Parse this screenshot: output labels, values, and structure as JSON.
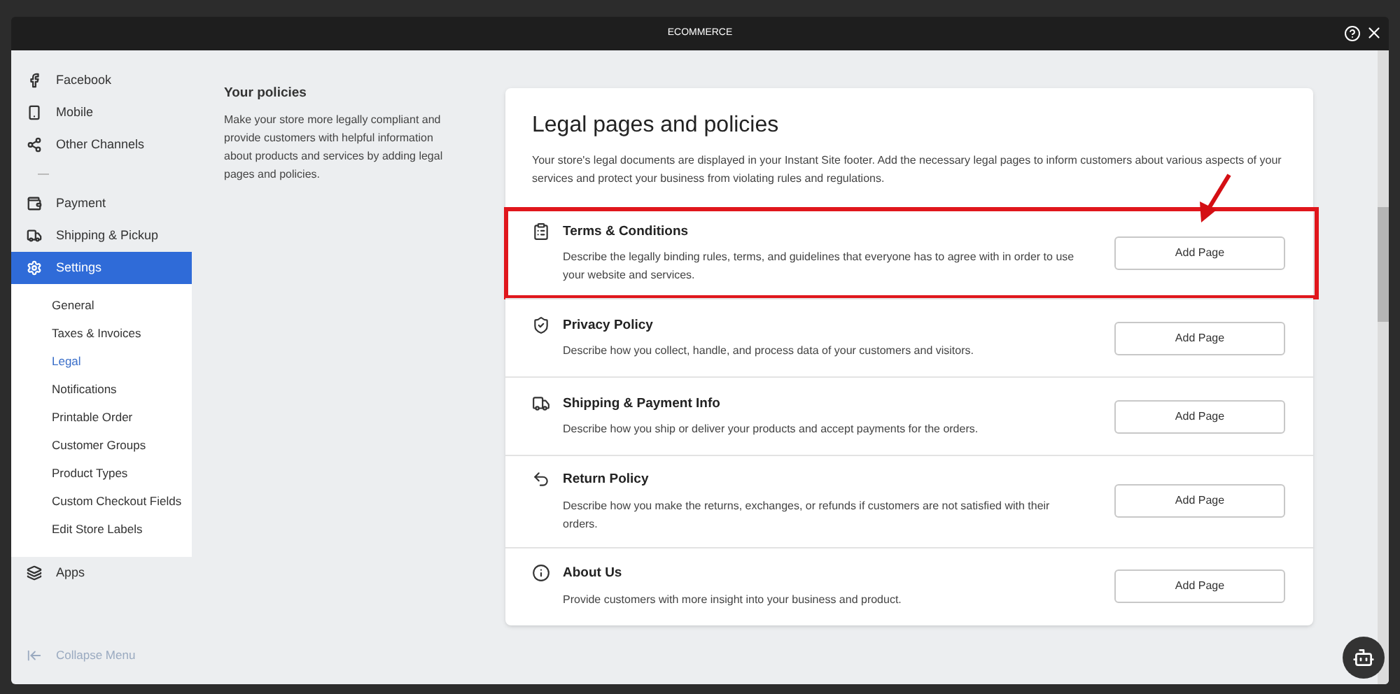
{
  "window": {
    "title": "ECOMMERCE"
  },
  "sidebar": {
    "groups": [
      [
        {
          "label": "Facebook",
          "selected": false
        },
        {
          "label": "Mobile",
          "selected": false
        },
        {
          "label": "Other Channels",
          "selected": false
        }
      ],
      [
        {
          "label": "Payment",
          "selected": false
        },
        {
          "label": "Shipping & Pickup",
          "selected": false
        },
        {
          "label": "Settings",
          "selected": true,
          "expanded": true,
          "children": [
            {
              "label": "General",
              "selected": false
            },
            {
              "label": "Taxes & Invoices",
              "selected": false
            },
            {
              "label": "Legal",
              "selected": true
            },
            {
              "label": "Notifications",
              "selected": false
            },
            {
              "label": "Printable Order",
              "selected": false
            },
            {
              "label": "Customer Groups",
              "selected": false
            },
            {
              "label": "Product Types",
              "selected": false
            },
            {
              "label": "Custom Checkout Fields",
              "selected": false
            },
            {
              "label": "Edit Store Labels",
              "selected": false
            }
          ]
        },
        {
          "label": "Apps",
          "selected": false
        }
      ]
    ],
    "collapse_label": "Collapse Menu"
  },
  "intro": {
    "title": "Your policies",
    "text": "Make your store more legally compliant and provide customers with helpful information about products and services by adding legal pages and policies."
  },
  "card": {
    "title": "Legal pages and policies",
    "description": "Your store's legal documents are displayed in your Instant Site footer. Add the necessary legal pages to inform customers about various aspects of your services and protect your business from violating rules and regulations.",
    "pages": [
      {
        "title": "Terms & Conditions",
        "description": "Describe the legally binding rules, terms, and guidelines that everyone has to agree with in order to use your website and services.",
        "button": "Add Page",
        "highlighted": true
      },
      {
        "title": "Privacy Policy",
        "description": "Describe how you collect, handle, and process data of your customers and visitors.",
        "button": "Add Page",
        "highlighted": false
      },
      {
        "title": "Shipping & Payment Info",
        "description": "Describe how you ship or deliver your products and accept payments for the orders.",
        "button": "Add Page",
        "highlighted": false
      },
      {
        "title": "Return Policy",
        "description": "Describe how you make the returns, exchanges, or refunds if customers are not satisfied with their orders.",
        "button": "Add Page",
        "highlighted": false
      },
      {
        "title": "About Us",
        "description": "Provide customers with more insight into your business and product.",
        "button": "Add Page",
        "highlighted": false
      }
    ]
  }
}
